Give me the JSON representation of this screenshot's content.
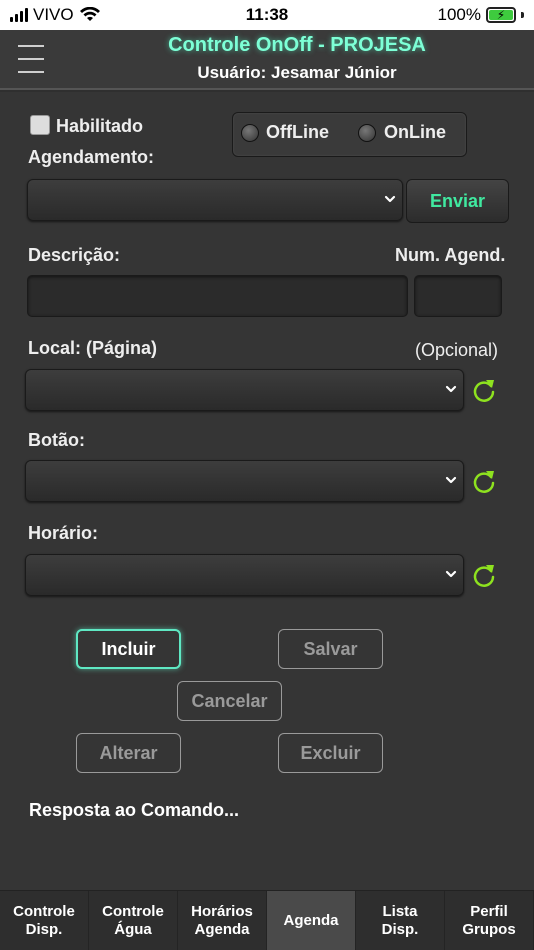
{
  "status_bar": {
    "carrier": "VIVO",
    "time": "11:38",
    "battery": "100%"
  },
  "header": {
    "title": "Controle OnOff - PROJESA",
    "user": "Usuário: Jesamar Júnior"
  },
  "form": {
    "enabled_label": "Habilitado",
    "offline_label": "OffLine",
    "online_label": "OnLine",
    "schedule_label": "Agendamento:",
    "send_button": "Enviar",
    "description_label": "Descrição:",
    "num_schedule_label": "Num. Agend.",
    "location_label": "Local: (Página)",
    "optional_label": "(Opcional)",
    "button_label": "Botão:",
    "time_label": "Horário:"
  },
  "actions": {
    "include": "Incluir",
    "save": "Salvar",
    "cancel": "Cancelar",
    "alter": "Alterar",
    "delete": "Excluir"
  },
  "response": "Resposta ao Comando...",
  "tabs": [
    {
      "line1": "Controle",
      "line2": "Disp."
    },
    {
      "line1": "Controle",
      "line2": "Água"
    },
    {
      "line1": "Horários",
      "line2": "Agenda"
    },
    {
      "line1": "Agenda",
      "line2": ""
    },
    {
      "line1": "Lista",
      "line2": "Disp."
    },
    {
      "line1": "Perfil",
      "line2": "Grupos"
    }
  ],
  "colors": {
    "accent": "#5fe8c3",
    "send_text": "#40e9a0",
    "refresh_icon": "#8ee21f"
  }
}
